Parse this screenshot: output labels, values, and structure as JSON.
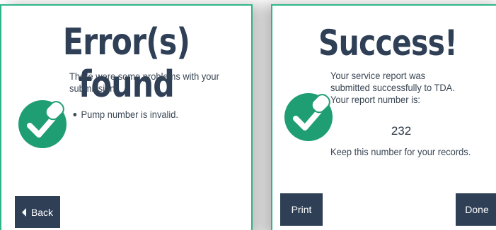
{
  "error_panel": {
    "title": "Error(s) found",
    "message": "There were some problems with your submission:",
    "errors": [
      "Pump number is invalid."
    ],
    "back_label": "Back",
    "icon": "check-circle-icon"
  },
  "success_panel": {
    "title": "Success!",
    "message": "Your service report was submitted successfully to TDA. Your report number is:",
    "report_number": "232",
    "keep_message": "Keep this number for your records.",
    "print_label": "Print",
    "done_label": "Done",
    "icon": "check-circle-icon"
  },
  "colors": {
    "accent": "#2fb58b",
    "dark": "#2e3f56",
    "text": "#3a4654"
  }
}
